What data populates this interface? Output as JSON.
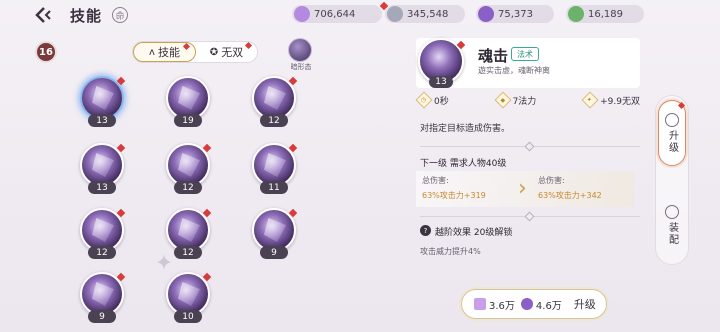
{
  "header": {
    "title": "技能",
    "help": "命"
  },
  "resources": [
    {
      "value": "706,644",
      "color": "#b48ae0"
    },
    {
      "value": "345,548",
      "color": "#a4a8b8"
    },
    {
      "value": "75,373",
      "color": "#8b5fc8"
    },
    {
      "value": "16,189",
      "color": "#6bb36a"
    }
  ],
  "level": "16",
  "tabs": [
    {
      "label": "技能",
      "icon": "ᴧ",
      "active": true
    },
    {
      "label": "无双",
      "icon": "✪",
      "active": false
    }
  ],
  "form_chip": {
    "label": "暗形态"
  },
  "skills": [
    {
      "level": "13"
    },
    {
      "level": "19"
    },
    {
      "level": "12"
    },
    {
      "level": "13"
    },
    {
      "level": "12"
    },
    {
      "level": "11"
    },
    {
      "level": "12"
    },
    {
      "level": "12"
    },
    {
      "level": "9"
    },
    {
      "level": "9"
    },
    {
      "level": "10"
    }
  ],
  "detail": {
    "name": "魂击",
    "type": "法术",
    "subtitle": "遊实击虚，魂断神离",
    "level": "13",
    "stats": [
      {
        "icon": "time",
        "value": "0秒"
      },
      {
        "icon": "mana",
        "value": "7法力"
      },
      {
        "icon": "musou",
        "value": "+9.9无双"
      }
    ],
    "description": "对指定目标造成伤害。",
    "next_level": {
      "title": "下一级 需求人物40级",
      "current_label": "总伤害:",
      "current_value": "63%攻击力+319",
      "next_label": "总伤害:",
      "next_value": "63%攻击力+342"
    },
    "advance": {
      "title": "越阶效果 20级解锁",
      "desc": "攻击威力提升4%"
    },
    "upgrade": {
      "cost1": "3.6万",
      "cost1_color": "#c9a0e8",
      "cost2": "4.6万",
      "cost2_color": "#8b5fc8",
      "label": "升级"
    }
  },
  "side_tabs": [
    {
      "label": "升级",
      "active": true
    },
    {
      "label": "装配",
      "active": false
    }
  ]
}
